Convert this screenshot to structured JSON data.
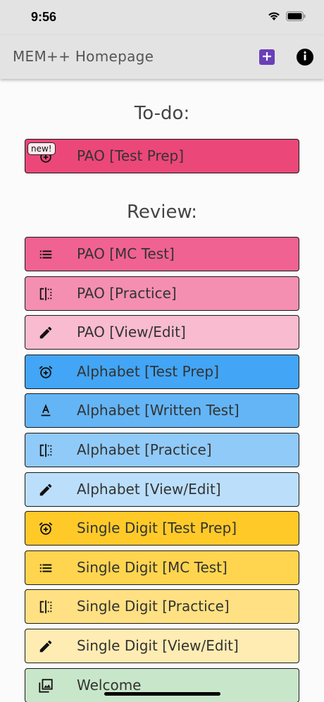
{
  "status_bar": {
    "time": "9:56"
  },
  "app_bar": {
    "title": "MEM++ Homepage"
  },
  "todo": {
    "heading": "To-do:",
    "items": [
      {
        "label": "PAO [Test Prep]",
        "icon": "alarm-add-icon",
        "badge": "new!",
        "color": "#ec4779"
      }
    ]
  },
  "review": {
    "heading": "Review:",
    "items": [
      {
        "label": "PAO [MC Test]",
        "icon": "list-icon",
        "color": "#f06292"
      },
      {
        "label": "PAO [Practice]",
        "icon": "flip-icon",
        "color": "#f48fb1"
      },
      {
        "label": "PAO [View/Edit]",
        "icon": "edit-icon",
        "color": "#f8bbd0"
      },
      {
        "label": "Alphabet [Test Prep]",
        "icon": "alarm-add-icon",
        "color": "#42a5f5"
      },
      {
        "label": "Alphabet [Written Test]",
        "icon": "text-format-icon",
        "color": "#64b5f6"
      },
      {
        "label": "Alphabet [Practice]",
        "icon": "flip-icon",
        "color": "#90caf9"
      },
      {
        "label": "Alphabet [View/Edit]",
        "icon": "edit-icon",
        "color": "#bbdefb"
      },
      {
        "label": "Single Digit [Test Prep]",
        "icon": "alarm-add-icon",
        "color": "#ffca28"
      },
      {
        "label": "Single Digit [MC Test]",
        "icon": "list-icon",
        "color": "#ffd54f"
      },
      {
        "label": "Single Digit [Practice]",
        "icon": "flip-icon",
        "color": "#ffe082"
      },
      {
        "label": "Single Digit [View/Edit]",
        "icon": "edit-icon",
        "color": "#ffecb3"
      },
      {
        "label": "Welcome",
        "icon": "photo-library-icon",
        "color": "#c8e6c9"
      }
    ]
  }
}
